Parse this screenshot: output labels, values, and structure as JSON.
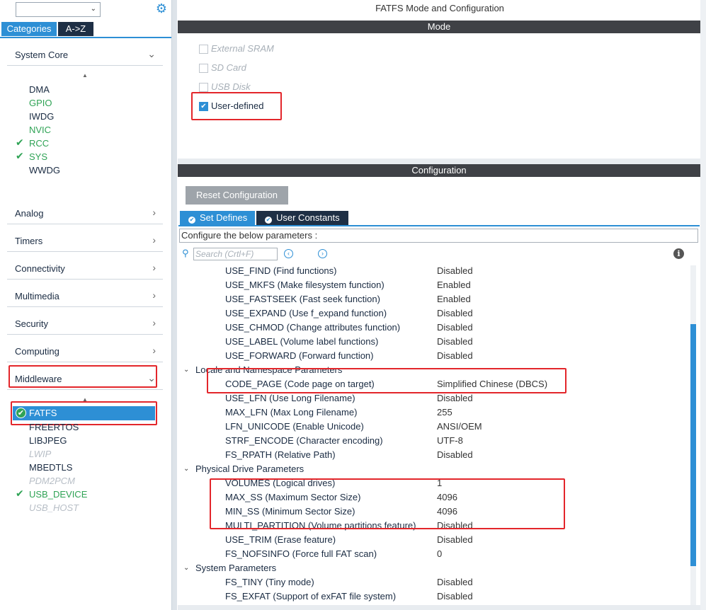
{
  "left_panel": {
    "search_value": "",
    "tabs": {
      "categories": "Categories",
      "az": "A->Z"
    },
    "categories": [
      {
        "label": "System Core"
      },
      {
        "label": "Analog"
      },
      {
        "label": "Timers"
      },
      {
        "label": "Connectivity"
      },
      {
        "label": "Multimedia"
      },
      {
        "label": "Security"
      },
      {
        "label": "Computing"
      },
      {
        "label": "Middleware"
      }
    ],
    "system_core_items": [
      "DMA",
      "GPIO",
      "IWDG",
      "NVIC",
      "RCC",
      "SYS",
      "WWDG"
    ],
    "middleware_items": [
      "FATFS",
      "FREERTOS",
      "LIBJPEG",
      "LWIP",
      "MBEDTLS",
      "PDM2PCM",
      "USB_DEVICE",
      "USB_HOST"
    ]
  },
  "right_panel": {
    "title": "FATFS Mode and Configuration",
    "mode_header": "Mode",
    "mode_options": [
      {
        "label": "External SRAM",
        "checked": false
      },
      {
        "label": "SD Card",
        "checked": false
      },
      {
        "label": "USB Disk",
        "checked": false
      },
      {
        "label": "User-defined",
        "checked": true
      }
    ],
    "config_header": "Configuration",
    "reset_button": "Reset Configuration",
    "config_tabs": [
      "Set Defines",
      "User Constants"
    ],
    "configure_label": "Configure the below parameters :",
    "search_placeholder": "Search (Crtl+F)",
    "params": [
      {
        "name": "USE_FIND (Find functions)",
        "value": "Disabled"
      },
      {
        "name": "USE_MKFS (Make filesystem function)",
        "value": "Enabled"
      },
      {
        "name": "USE_FASTSEEK (Fast seek function)",
        "value": "Enabled"
      },
      {
        "name": "USE_EXPAND (Use f_expand function)",
        "value": "Disabled"
      },
      {
        "name": "USE_CHMOD (Change attributes function)",
        "value": "Disabled"
      },
      {
        "name": "USE_LABEL (Volume label functions)",
        "value": "Disabled"
      },
      {
        "name": "USE_FORWARD (Forward function)",
        "value": "Disabled"
      }
    ],
    "group_locale": "Locale and Namespace Parameters",
    "locale_params": [
      {
        "name": "CODE_PAGE (Code page on target)",
        "value": "Simplified Chinese (DBCS)"
      },
      {
        "name": "USE_LFN (Use Long Filename)",
        "value": "Disabled"
      },
      {
        "name": "MAX_LFN (Max Long Filename)",
        "value": "255"
      },
      {
        "name": "LFN_UNICODE (Enable Unicode)",
        "value": "ANSI/OEM"
      },
      {
        "name": "STRF_ENCODE (Character encoding)",
        "value": "UTF-8"
      },
      {
        "name": "FS_RPATH (Relative Path)",
        "value": "Disabled"
      }
    ],
    "group_physical": "Physical Drive Parameters",
    "physical_params": [
      {
        "name": "VOLUMES (Logical drives)",
        "value": "1"
      },
      {
        "name": "MAX_SS (Maximum Sector Size)",
        "value": "4096"
      },
      {
        "name": "MIN_SS (Minimum Sector Size)",
        "value": "4096"
      },
      {
        "name": "MULTI_PARTITION (Volume partitions feature)",
        "value": "Disabled"
      },
      {
        "name": "USE_TRIM (Erase feature)",
        "value": "Disabled"
      },
      {
        "name": "FS_NOFSINFO (Force full FAT scan)",
        "value": "0"
      }
    ],
    "group_system": "System Parameters",
    "system_params": [
      {
        "name": "FS_TINY (Tiny mode)",
        "value": "Disabled"
      },
      {
        "name": "FS_EXFAT (Support of exFAT file system)",
        "value": "Disabled"
      }
    ]
  },
  "colors": {
    "accent": "#2d8fd5",
    "green": "#2fa355",
    "highlight": "#e3262b",
    "dark_header": "#3f4146"
  }
}
